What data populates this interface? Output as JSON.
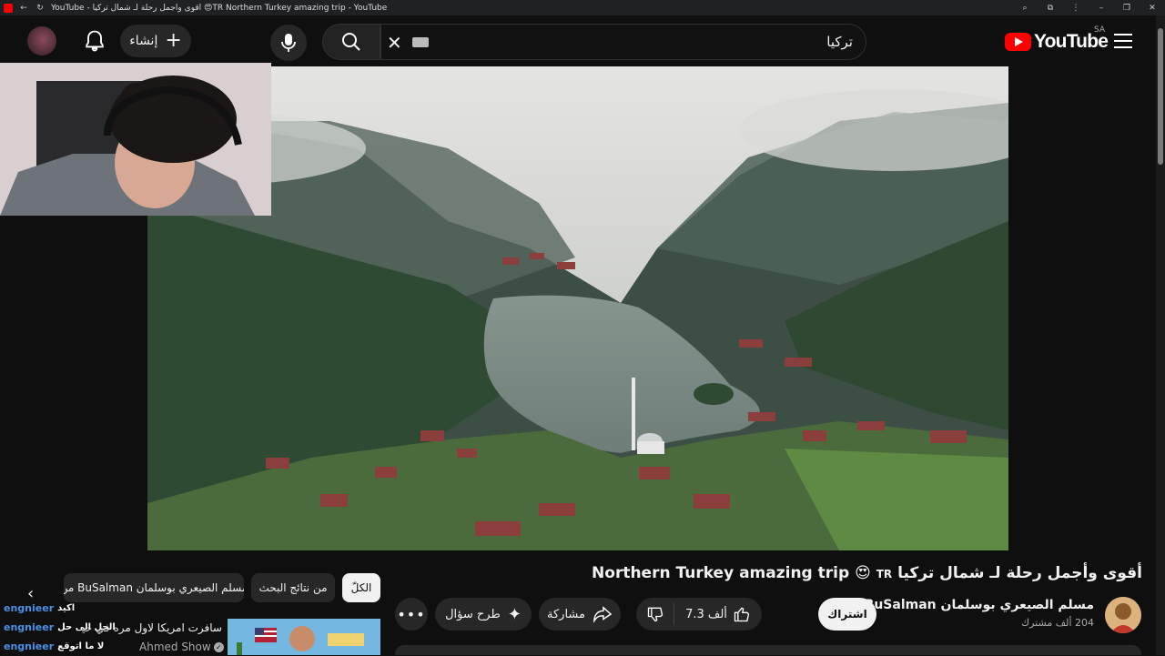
{
  "browser": {
    "tab_title": "YouTube - أقوى وأجمل رحلة لـ شمال تركيا 😍TR Northern Turkey amazing trip - YouTube"
  },
  "header": {
    "create_label": "إنشاء",
    "search_query": "تركيا",
    "logo_text": "YouTube",
    "country_code": "SA"
  },
  "chips": {
    "all": "الكلّ",
    "from_search": "من نتائج البحث",
    "from_channel": "من BuSalman مسلم الصيعري بوسلمان"
  },
  "video": {
    "title_main": "أقوى وأجمل رحلة لـ شمال تركيا Northern Turkey amazing trip",
    "title_emoji": "😍",
    "title_badge": "TR",
    "channel_name": "مسلم الصيعري بوسلمان BuSalman",
    "subscribers": "204 ألف مشترك",
    "subscribe_label": "اشتراك",
    "likes": "7.3 ألف",
    "share_label": "مشاركة",
    "ask_label": "طرح سؤال",
    "more_label": "•••"
  },
  "recommended": {
    "title": "سافرت امريكا لاول مره في حياتي !",
    "channel": "Ahmed Show"
  },
  "chat": [
    {
      "user": "engnieer",
      "message": "اكيد"
    },
    {
      "user": "engnieer",
      "message": "الحل الى حل"
    },
    {
      "user": "engnieer",
      "message": "لا ما اتوقع"
    }
  ],
  "colors": {
    "background": "#0f0f0f",
    "accent": "#ff0000",
    "chat_user": "#4d8fe6"
  }
}
